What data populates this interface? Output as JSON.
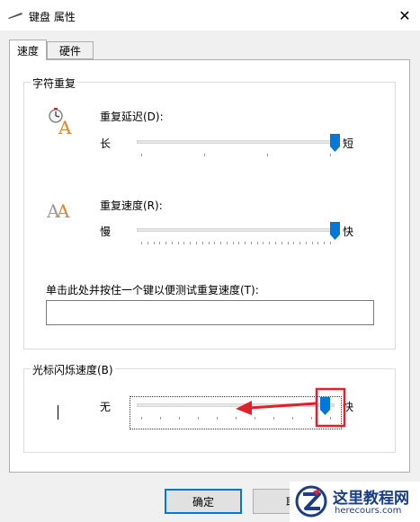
{
  "window": {
    "title": "键盘 属性",
    "close_icon": "close-icon"
  },
  "tabs": [
    {
      "label": "速度",
      "active": true
    },
    {
      "label": "硬件",
      "active": false
    }
  ],
  "char_repeat": {
    "legend": "字符重复",
    "delay": {
      "label": "重复延迟(D):",
      "min_label": "长",
      "max_label": "短",
      "value": 1.0
    },
    "rate": {
      "label": "重复速度(R):",
      "min_label": "慢",
      "max_label": "快",
      "value": 1.0
    },
    "test": {
      "label": "单击此处并按住一个键以便测试重复速度(T):",
      "value": ""
    }
  },
  "cursor_blink": {
    "legend": "光标闪烁速度(B)",
    "min_label": "无",
    "max_label": "快",
    "value": 0.95
  },
  "buttons": {
    "ok": "确定",
    "cancel": "取"
  },
  "watermark": {
    "title": "这里教程网",
    "url": "herecours.com"
  },
  "colors": {
    "accent": "#0078d7",
    "annotation": "#e0202a"
  }
}
